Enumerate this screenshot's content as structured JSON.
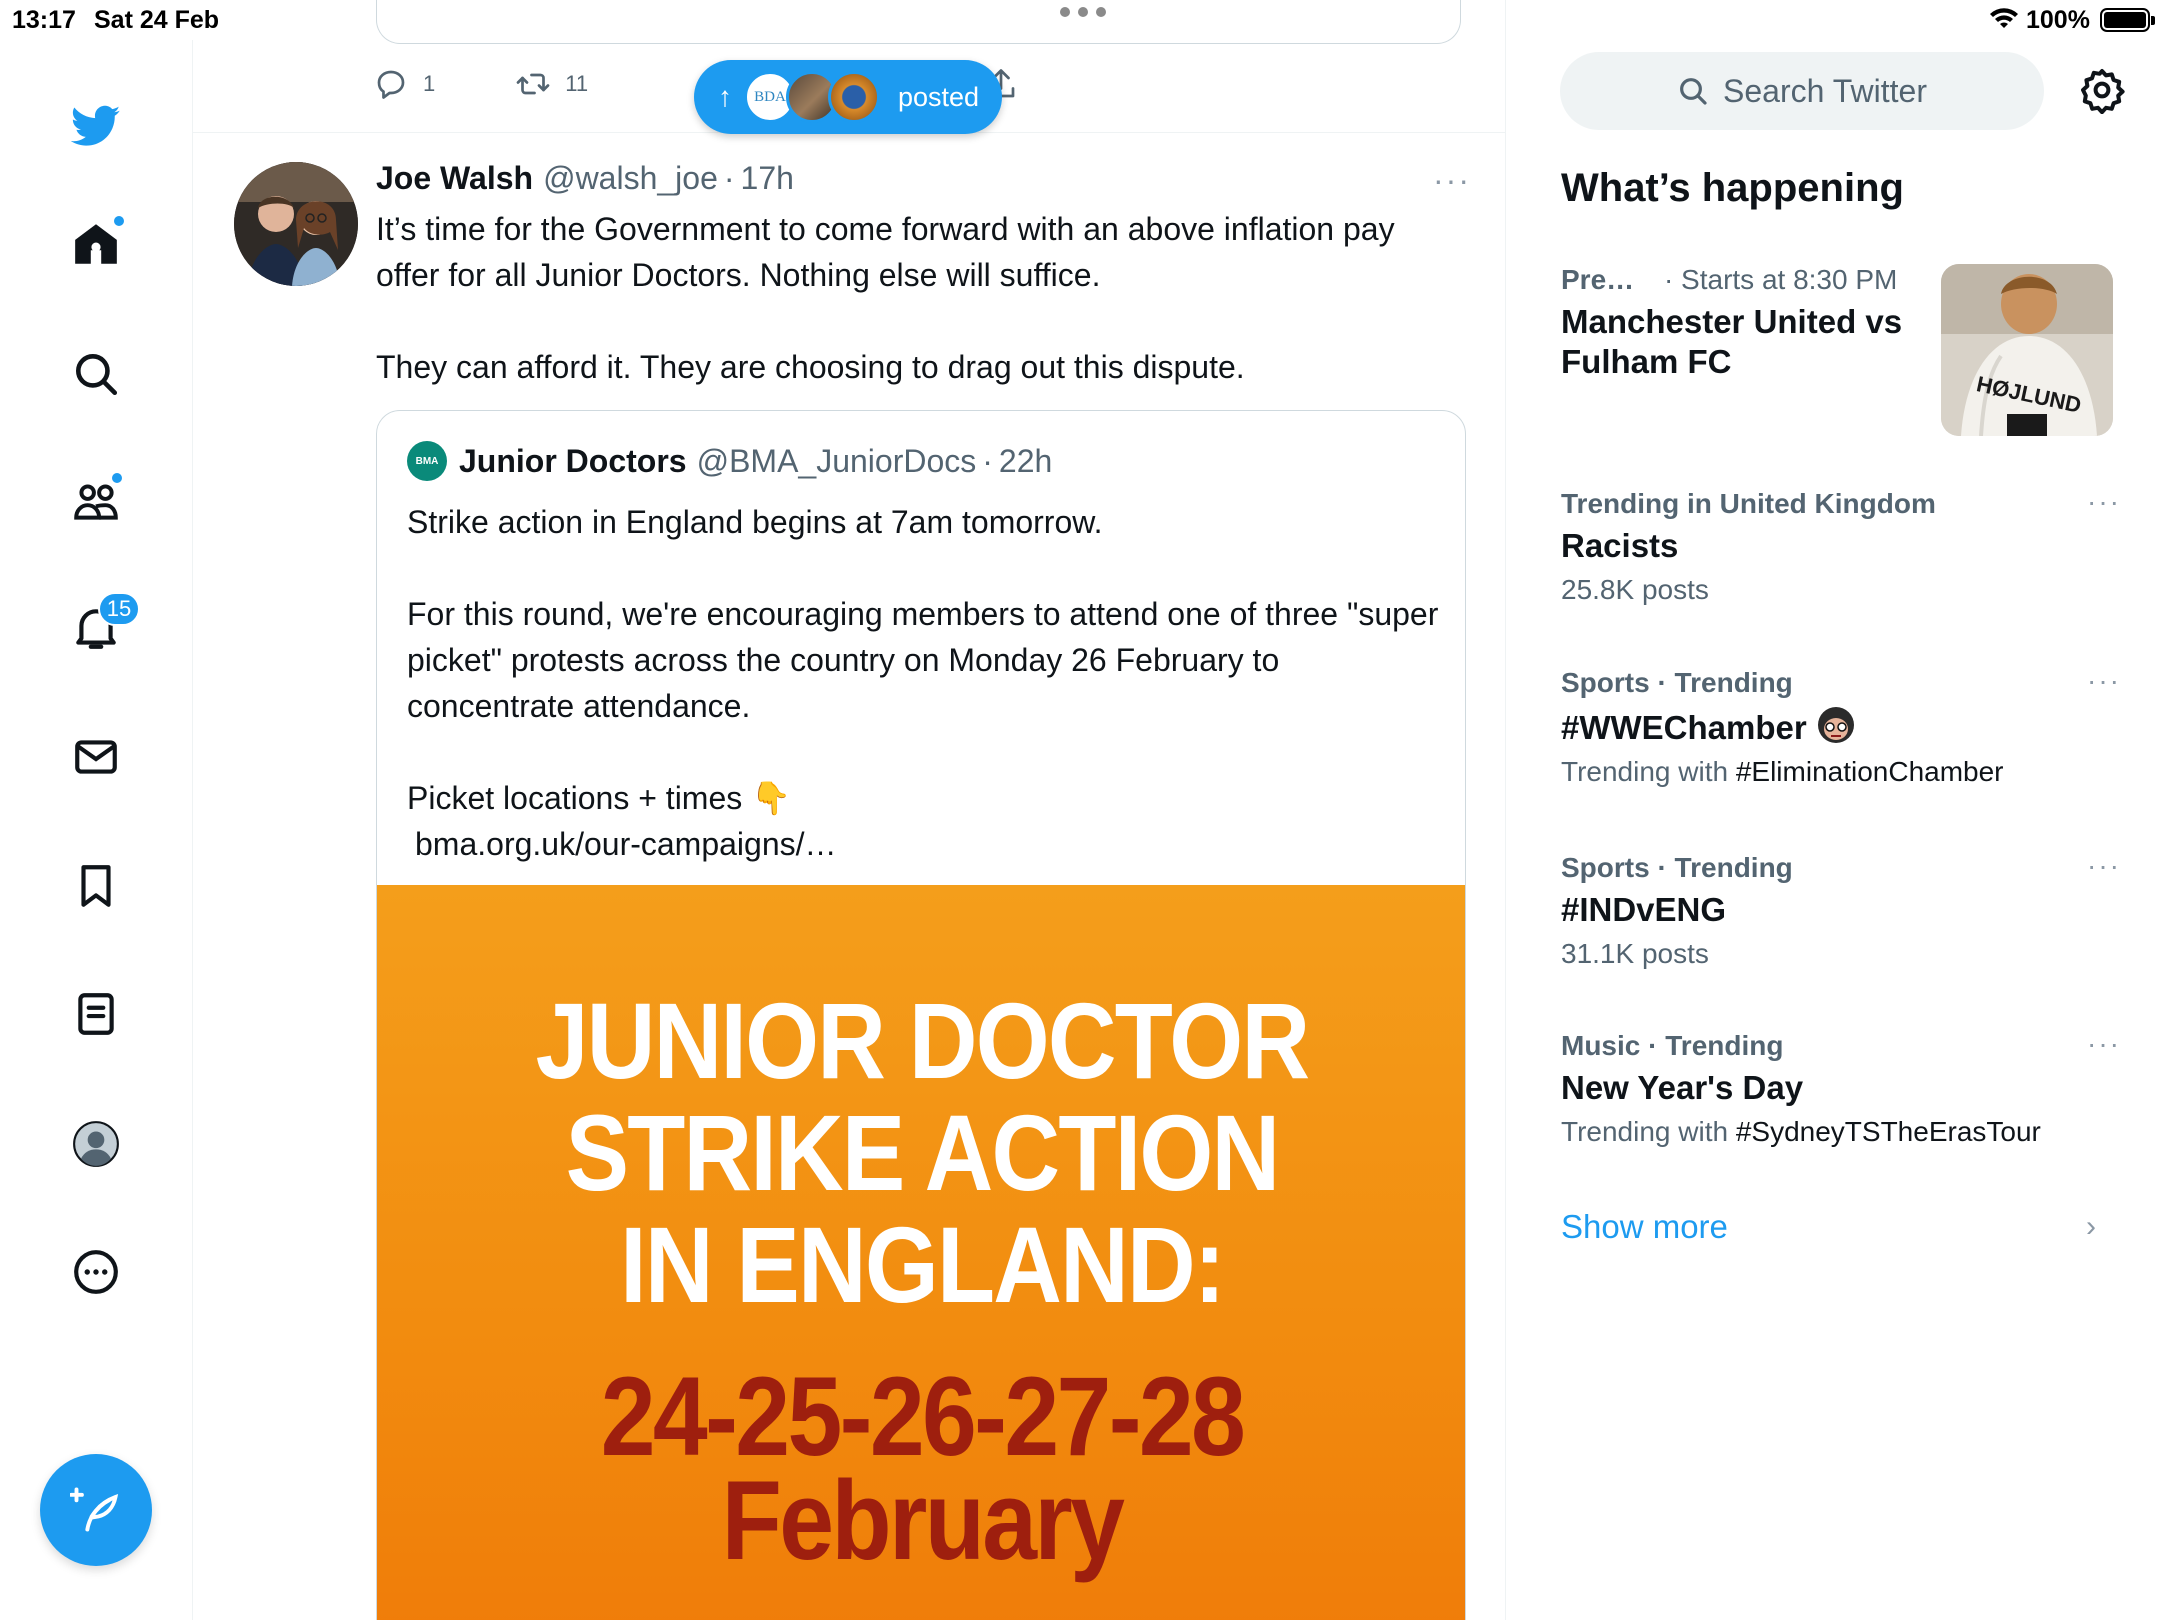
{
  "status_bar": {
    "time": "13:17",
    "date": "Sat 24 Feb",
    "battery": "100%"
  },
  "nav": {
    "notifications_count": "15",
    "items": [
      "logo",
      "home",
      "explore",
      "communities",
      "notifications",
      "messages",
      "bookmarks",
      "lists",
      "profile",
      "more"
    ],
    "compose_icon": "feather-plus-icon"
  },
  "previous_tweet": {
    "reply_count": "1",
    "retweet_count": "11"
  },
  "new_posts_pill": {
    "label": "posted",
    "avatar_label": "BDA"
  },
  "tweet": {
    "name": "Joe Walsh",
    "handle": "@walsh_joe",
    "separator": "·",
    "time": "17h",
    "more": "···",
    "paragraphs": [
      "It’s time for the Government to come forward with an above inflation pay offer for all Junior Doctors. Nothing else will suffice.",
      "They can afford it. They are choosing to drag out this dispute."
    ]
  },
  "quoted_tweet": {
    "avatar_label": "BMA",
    "name": "Junior Doctors",
    "handle": "@BMA_JuniorDocs",
    "separator": "·",
    "time": "22h",
    "paragraph1": "Strike action in England begins at 7am tomorrow.",
    "paragraph2": "For this round, we're encouraging members to attend one of three \"super picket\" protests across the country on Monday 26 February to concentrate attendance.",
    "paragraph3": "Picket locations + times 👇",
    "link": "bma.org.uk/our-campaigns/…",
    "image": {
      "headline_lines": [
        "JUNIOR DOCTOR",
        "STRIKE ACTION",
        "IN ENGLAND:"
      ],
      "dates_lines": [
        "24-25-26-27-28",
        "February"
      ]
    }
  },
  "sidebar": {
    "search_placeholder": "Search Twitter",
    "whats_happening": "What’s happening",
    "event": {
      "category": "Pre…",
      "starts": "· Starts at 8:30 PM",
      "title": "Manchester United vs Fulham FC",
      "thumb_text": "HØJLUND"
    },
    "trends": [
      {
        "meta": "Trending in United Kingdom",
        "title": "Racists",
        "sub": "25.8K posts",
        "sub_tag": ""
      },
      {
        "meta": "Sports · Trending",
        "title": "#WWEChamber",
        "sub": "Trending with ",
        "sub_tag": "#EliminationChamber"
      },
      {
        "meta": "Sports · Trending",
        "title": "#INDvENG",
        "sub": "31.1K posts",
        "sub_tag": ""
      },
      {
        "meta": "Music · Trending",
        "title": "New Year's Day",
        "sub": "Trending with ",
        "sub_tag": "#SydneyTSTheErasTour"
      }
    ],
    "more_dots": "···",
    "show_more": "Show more"
  },
  "colors": {
    "accent": "#1d9bf0",
    "text_secondary": "#536471",
    "image_orange": "#f28c0f",
    "image_dates": "#9e1f0e"
  }
}
